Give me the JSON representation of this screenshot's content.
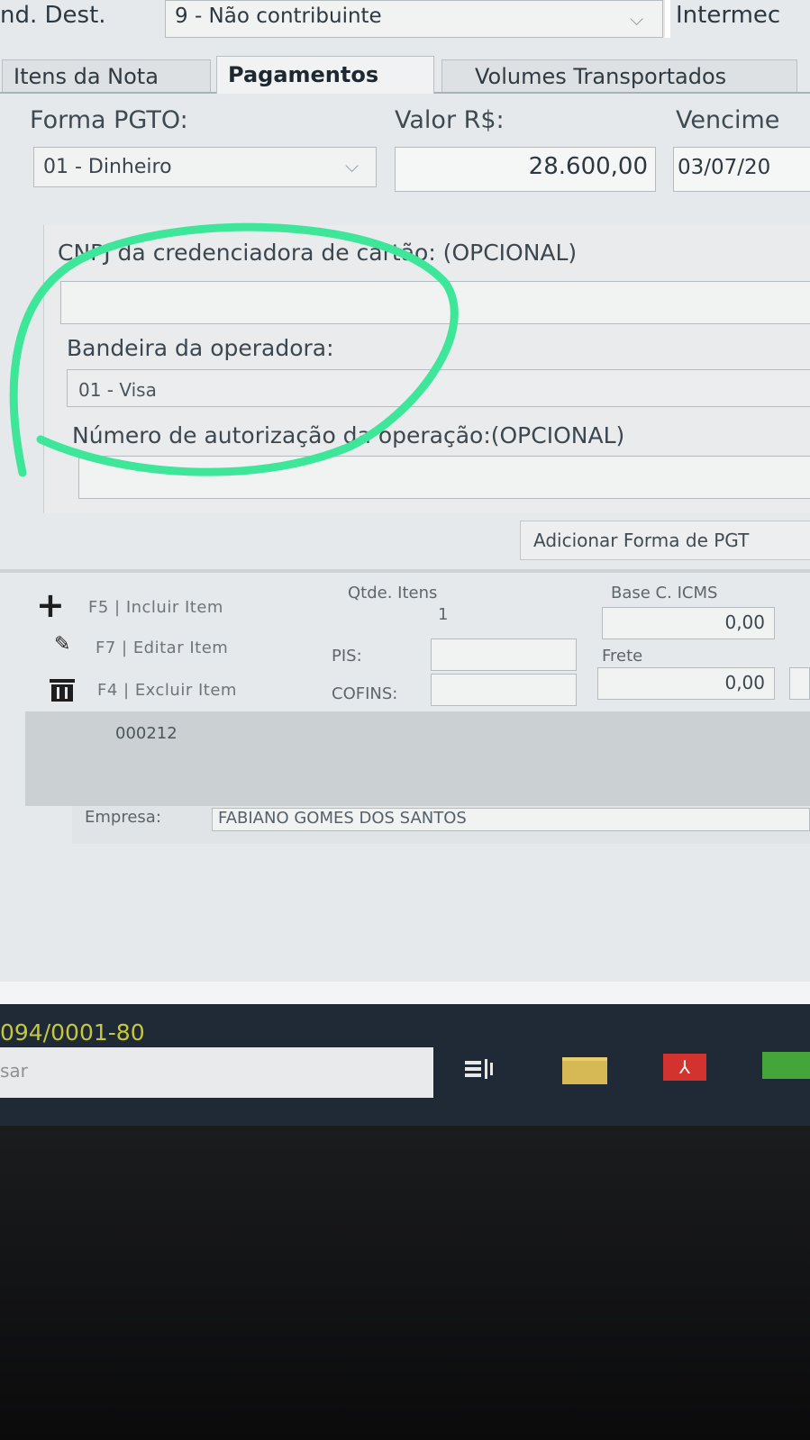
{
  "header": {
    "ind_dest_label": "nd. Dest.",
    "ind_dest_value": "9 - Não contribuinte",
    "intermed_label": "Intermec"
  },
  "tabs": [
    {
      "label": "Itens da Nota"
    },
    {
      "label": "Pagamentos"
    },
    {
      "label": "Volumes Transportados"
    }
  ],
  "payment": {
    "forma_label": "Forma PGTO:",
    "forma_value": "01 - Dinheiro",
    "valor_label": "Valor R$:",
    "valor_value": "28.600,00",
    "vencimento_label": "Vencime",
    "vencimento_value": "03/07/20"
  },
  "card": {
    "cnpj_label": "CNPJ da credenciadora de cartão: (OPCIONAL)",
    "bandeira_label": "Bandeira da operadora:",
    "bandeira_value": "01 - Visa",
    "autorizacao_label": "Número de autorização da operação:(OPCIONAL)"
  },
  "add_forma_label": "Adicionar Forma de PGT",
  "actions": {
    "include_label": "F5 | Incluir Item",
    "edit_label": "F7 | Editar Item",
    "delete_label": "F4 | Excluir Item"
  },
  "totals": {
    "qtde_itens_label": "Qtde. Itens",
    "qtde_itens_value": "1",
    "pis_label": "PIS:",
    "cofins_label": "COFINS:",
    "base_icms_label": "Base C. ICMS",
    "base_icms_value": "0,00",
    "frete_label": "Frete",
    "frete_value": "0,00"
  },
  "grid": {
    "row_code": "000212"
  },
  "company": {
    "label": "Empresa:",
    "value": "FABIANO GOMES DOS SANTOS"
  },
  "status": {
    "cnpj_fragment": "094/0001-80",
    "search_fragment": "sar"
  },
  "colors": {
    "annotation_green": "#3ee69a",
    "status_text": "#c4c83a"
  }
}
